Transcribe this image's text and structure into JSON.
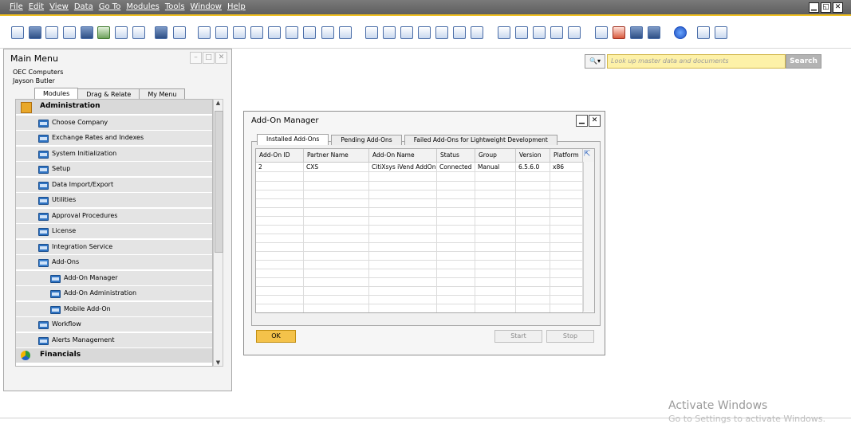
{
  "menubar": {
    "items": [
      "File",
      "Edit",
      "View",
      "Data",
      "Go To",
      "Modules",
      "Tools",
      "Window",
      "Help"
    ],
    "window_controls": [
      "▁",
      "◱",
      "✕"
    ]
  },
  "main_menu": {
    "title": "Main Menu",
    "company": "OEC Computers",
    "user": "Jayson Butler",
    "window_controls": [
      "–",
      "□",
      "✕"
    ],
    "tabs": [
      "Modules",
      "Drag & Relate",
      "My Menu"
    ],
    "items": [
      {
        "label": "Administration",
        "level": "head",
        "icon": "admin-icon"
      },
      {
        "label": "Choose Company",
        "level": 1,
        "icon": "folder-icon"
      },
      {
        "label": "Exchange Rates and Indexes",
        "level": 1,
        "icon": "folder-icon"
      },
      {
        "label": "System Initialization",
        "level": 1,
        "icon": "folder-icon"
      },
      {
        "label": "Setup",
        "level": 1,
        "icon": "folder-icon"
      },
      {
        "label": "Data Import/Export",
        "level": 1,
        "icon": "folder-icon"
      },
      {
        "label": "Utilities",
        "level": 1,
        "icon": "folder-icon"
      },
      {
        "label": "Approval Procedures",
        "level": 1,
        "icon": "folder-icon"
      },
      {
        "label": "License",
        "level": 1,
        "icon": "folder-icon"
      },
      {
        "label": "Integration Service",
        "level": 1,
        "icon": "folder-icon"
      },
      {
        "label": "Add-Ons",
        "level": 1,
        "icon": "open-folder-icon"
      },
      {
        "label": "Add-On Manager",
        "level": 2,
        "icon": "form-icon"
      },
      {
        "label": "Add-On Administration",
        "level": 2,
        "icon": "form-icon"
      },
      {
        "label": "Mobile Add-On",
        "level": 2,
        "icon": "form-icon"
      },
      {
        "label": "Workflow",
        "level": 1,
        "icon": "folder-icon"
      },
      {
        "label": "Alerts Management",
        "level": 1,
        "icon": "folder-icon"
      },
      {
        "label": "Financials",
        "level": "head",
        "icon": "financials-icon"
      }
    ]
  },
  "search": {
    "placeholder": "Look up master data and documents",
    "button": "Search"
  },
  "addon_manager": {
    "title": "Add-On Manager",
    "window_controls": [
      "▁",
      "✕"
    ],
    "tabs": [
      "Installed Add-Ons",
      "Pending Add-Ons",
      "Failed Add-Ons for Lightweight Development"
    ],
    "columns": [
      "Add-On ID",
      "Partner Name",
      "Add-On Name",
      "Status",
      "Group",
      "Version",
      "Platform"
    ],
    "rows": [
      [
        "2",
        "CXS",
        "CitiXsys iVend AddOn",
        "Connected",
        "Manual",
        "6.5.6.0",
        "x86"
      ]
    ],
    "empty_rows": 16,
    "buttons": {
      "ok": "OK",
      "start": "Start",
      "stop": "Stop"
    }
  },
  "watermark": {
    "title": "Activate Windows",
    "subtitle": "Go to Settings to activate Windows."
  },
  "colors": {
    "menubar": "#6b6b6b",
    "accent": "#f0c020",
    "ok_button": "#f4c24a",
    "search_field": "#fdf1a8"
  }
}
